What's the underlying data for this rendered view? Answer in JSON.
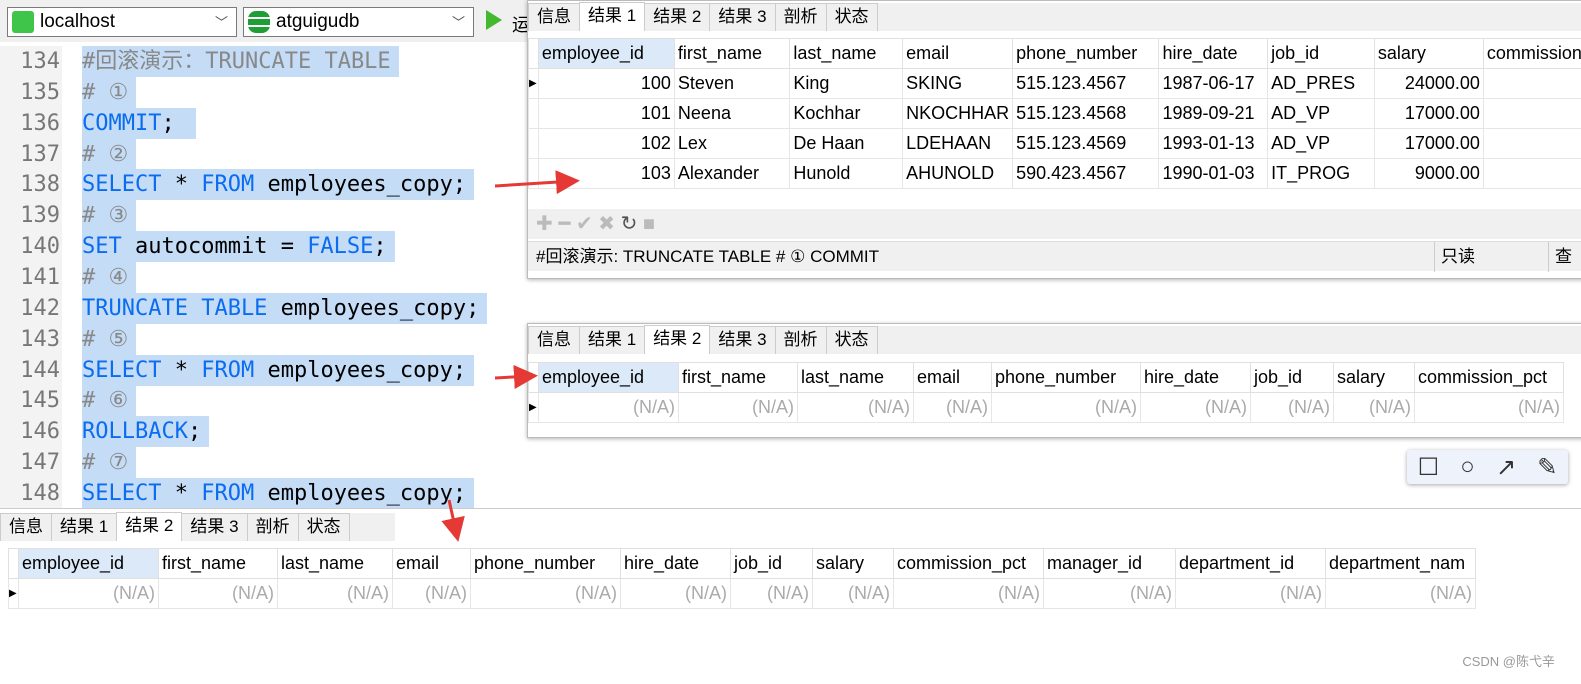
{
  "toolbar": {
    "connection": "localhost",
    "database": "atguigudb",
    "run_label": "运"
  },
  "editor": {
    "lines": [
      {
        "n": "134",
        "parts": [
          [
            "cm",
            "#回滚演示：TRUNCATE TABLE"
          ]
        ]
      },
      {
        "n": "135",
        "parts": [
          [
            "cm",
            "# ①"
          ]
        ]
      },
      {
        "n": "136",
        "parts": [
          [
            "kw",
            "COMMIT"
          ],
          [
            "",
            "; "
          ]
        ]
      },
      {
        "n": "137",
        "parts": [
          [
            "cm",
            "# ②"
          ]
        ]
      },
      {
        "n": "138",
        "parts": [
          [
            "kw",
            "SELECT"
          ],
          [
            "",
            " * "
          ],
          [
            "kw",
            "FROM"
          ],
          [
            "",
            " employees_copy;"
          ]
        ]
      },
      {
        "n": "139",
        "parts": [
          [
            "cm",
            "# ③"
          ]
        ]
      },
      {
        "n": "140",
        "parts": [
          [
            "kw",
            "SET"
          ],
          [
            "",
            " autocommit = "
          ],
          [
            "kw",
            "FALSE"
          ],
          [
            "",
            ";"
          ]
        ]
      },
      {
        "n": "141",
        "parts": [
          [
            "cm",
            "# ④"
          ]
        ]
      },
      {
        "n": "142",
        "parts": [
          [
            "kw",
            "TRUNCATE TABLE"
          ],
          [
            "",
            " employees_copy;"
          ]
        ]
      },
      {
        "n": "143",
        "parts": [
          [
            "cm",
            "# ⑤"
          ]
        ]
      },
      {
        "n": "144",
        "parts": [
          [
            "kw",
            "SELECT"
          ],
          [
            "",
            " * "
          ],
          [
            "kw",
            "FROM"
          ],
          [
            "",
            " employees_copy;"
          ]
        ]
      },
      {
        "n": "145",
        "parts": [
          [
            "cm",
            "# ⑥"
          ]
        ]
      },
      {
        "n": "146",
        "parts": [
          [
            "kw",
            "ROLLBACK"
          ],
          [
            "",
            ";"
          ]
        ]
      },
      {
        "n": "147",
        "parts": [
          [
            "cm",
            "# ⑦"
          ]
        ]
      },
      {
        "n": "148",
        "parts": [
          [
            "kw",
            "SELECT"
          ],
          [
            "",
            " * "
          ],
          [
            "kw",
            "FROM"
          ],
          [
            "",
            " employees_copy;"
          ]
        ]
      }
    ]
  },
  "tabs": [
    "信息",
    "结果 1",
    "结果 2",
    "结果 3",
    "剖析",
    "状态"
  ],
  "panel1": {
    "active_tab": 1,
    "columns": [
      "employee_id",
      "first_name",
      "last_name",
      "email",
      "phone_number",
      "hire_date",
      "job_id",
      "salary",
      "commission"
    ],
    "rows": [
      [
        "100",
        "Steven",
        "King",
        "SKING",
        "515.123.4567",
        "1987-06-17",
        "AD_PRES",
        "24000.00",
        ""
      ],
      [
        "101",
        "Neena",
        "Kochhar",
        "NKOCHHAR",
        "515.123.4568",
        "1989-09-21",
        "AD_VP",
        "17000.00",
        ""
      ],
      [
        "102",
        "Lex",
        "De Haan",
        "LDEHAAN",
        "515.123.4569",
        "1993-01-13",
        "AD_VP",
        "17000.00",
        ""
      ],
      [
        "103",
        "Alexander",
        "Hunold",
        "AHUNOLD",
        "590.423.4567",
        "1990-01-03",
        "IT_PROG",
        "9000.00",
        ""
      ]
    ],
    "status_sql": "#回滚演示:  TRUNCATE TABLE  # ① COMMIT",
    "status_readonly": "只读",
    "status_extra": "查"
  },
  "panel2": {
    "active_tab": 2,
    "columns": [
      "employee_id",
      "first_name",
      "last_name",
      "email",
      "phone_number",
      "hire_date",
      "job_id",
      "salary",
      "commission_pct"
    ],
    "rows": [
      [
        "(N/A)",
        "(N/A)",
        "(N/A)",
        "(N/A)",
        "(N/A)",
        "(N/A)",
        "(N/A)",
        "(N/A)",
        "(N/A)"
      ]
    ]
  },
  "panel3": {
    "active_tab": 2,
    "columns": [
      "employee_id",
      "first_name",
      "last_name",
      "email",
      "phone_number",
      "hire_date",
      "job_id",
      "salary",
      "commission_pct",
      "manager_id",
      "department_id",
      "department_nam"
    ],
    "rows": [
      [
        "(N/A)",
        "(N/A)",
        "(N/A)",
        "(N/A)",
        "(N/A)",
        "(N/A)",
        "(N/A)",
        "(N/A)",
        "(N/A)",
        "(N/A)",
        "(N/A)",
        "(N/A)"
      ]
    ]
  },
  "annotation_tools": [
    "rectangle-icon",
    "circle-icon",
    "arrow-icon",
    "pencil-icon"
  ],
  "watermark": "CSDN @陈弋辛",
  "colors": {
    "keyword": "#0a6cf0",
    "selection": "#c4dcf6",
    "arrow": "#e53935"
  }
}
